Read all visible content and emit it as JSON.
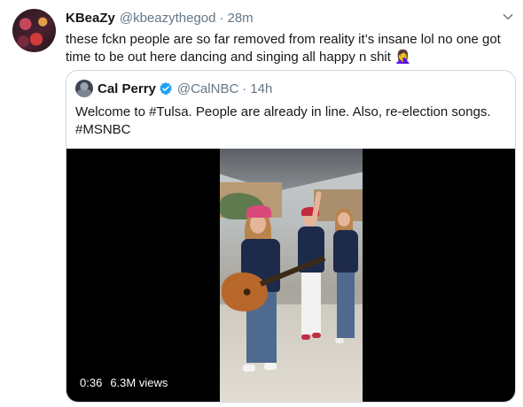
{
  "tweet": {
    "name": "KBeaZy",
    "handle": "@kbeazythegod",
    "separator": "·",
    "time": "28m",
    "text": "these fckn people are so far removed from reality it’s insane lol no one got time to be out here dancing and singing all happy n shit 🤦‍♀️"
  },
  "quoted_tweet": {
    "name": "Cal Perry",
    "handle": "@CalNBC",
    "separator": "·",
    "time": "14h",
    "text": "Welcome to #Tulsa. People are already in line. Also, re-election songs. #MSNBC"
  },
  "video": {
    "duration": "0:36",
    "views": "6.3M views"
  },
  "icons": {
    "menu": "chevron-down-icon",
    "verified": "verified-badge-icon"
  },
  "colors": {
    "name_text": "#14171a",
    "secondary_text": "#657786",
    "verified_blue": "#1da1f2",
    "border": "#ccd6dd"
  }
}
